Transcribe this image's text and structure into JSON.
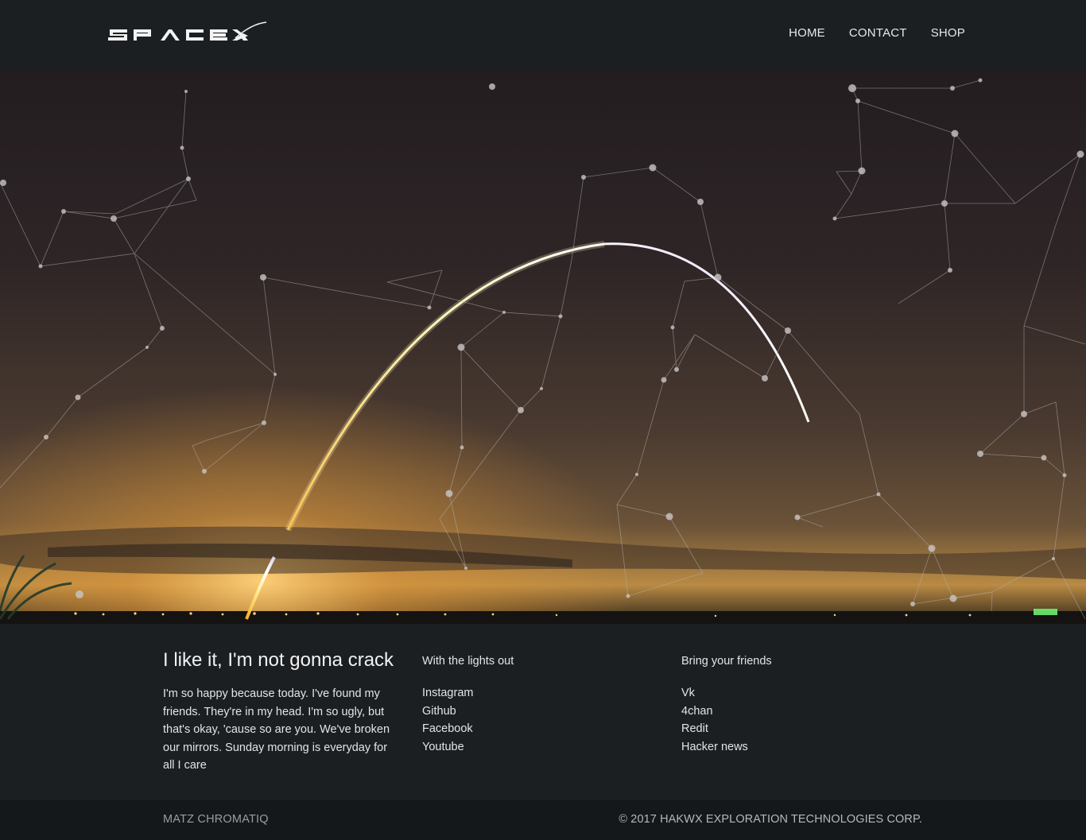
{
  "header": {
    "logo_alt": "SpaceX",
    "nav": [
      {
        "label": "HOME"
      },
      {
        "label": "CONTACT"
      },
      {
        "label": "SHOP"
      }
    ]
  },
  "intro": {
    "title": "I like it, I'm not gonna crack",
    "body": "I'm so happy because today. I've found my friends. They're in my head. I'm so ugly, but that's okay, 'cause so are you. We've broken our mirrors. Sunday morning is everyday for all I care"
  },
  "links_left": {
    "heading": "With the lights out",
    "items": [
      "Instagram",
      "Github",
      "Facebook",
      "Youtube"
    ]
  },
  "links_right": {
    "heading": "Bring your friends",
    "items": [
      "Vk",
      "4chan",
      "Redit",
      "Hacker news"
    ]
  },
  "footer": {
    "left": "MATZ CHROMATIQ",
    "right": "© 2017 HAKWX EXPLORATION TECHNOLOGIES CORP."
  },
  "colors": {
    "background": "#1b1f22",
    "footer": "#15181a",
    "sky_top": "#2a2325",
    "horizon_glow": "#f1a63a"
  }
}
